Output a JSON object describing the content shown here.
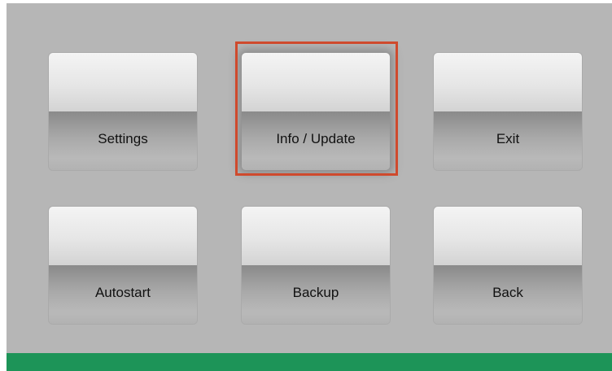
{
  "menu": {
    "buttons": [
      {
        "label": "Settings"
      },
      {
        "label": "Info / Update"
      },
      {
        "label": "Exit"
      },
      {
        "label": "Autostart"
      },
      {
        "label": "Backup"
      },
      {
        "label": "Back"
      }
    ],
    "selected": "Info / Update"
  },
  "colors": {
    "background": "#b6b6b6",
    "focus_frame": "#cf4a2d",
    "status_bar": "#1d9458"
  }
}
